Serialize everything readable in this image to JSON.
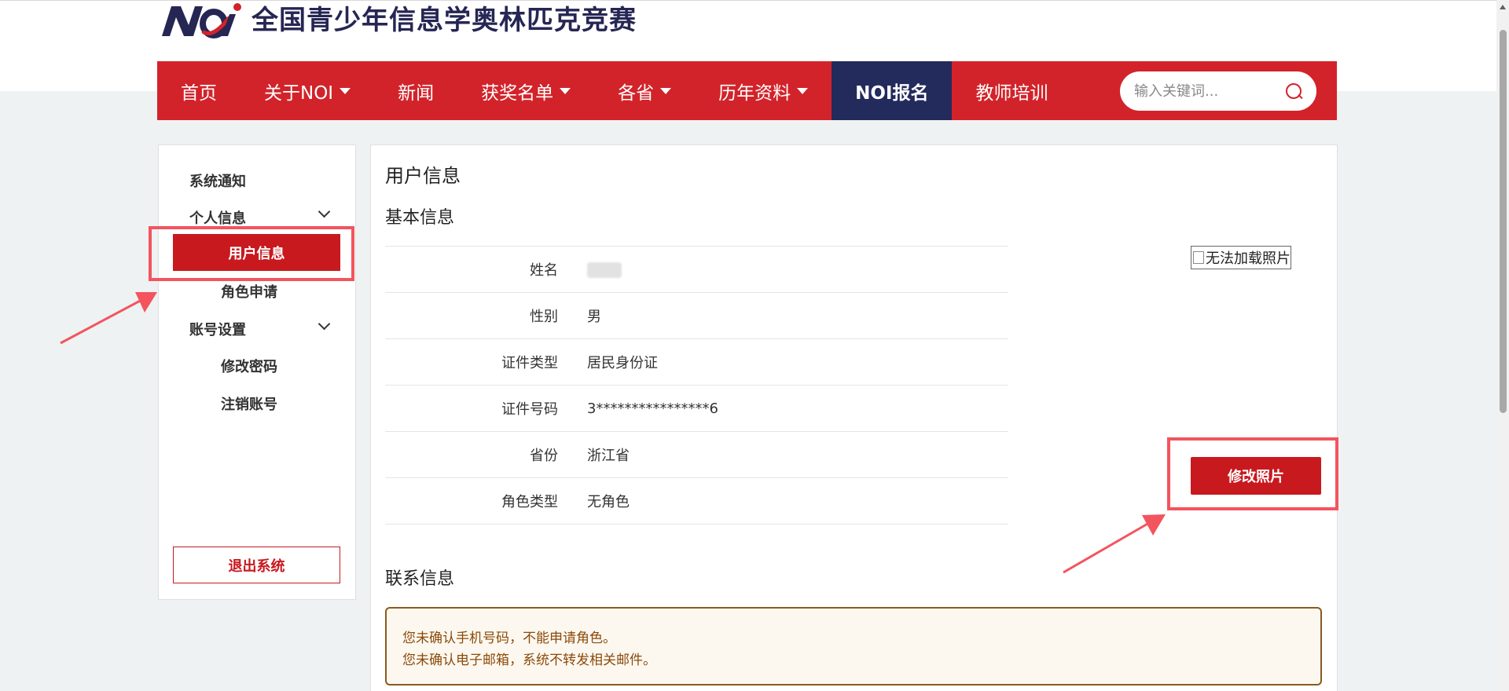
{
  "header": {
    "site_title": "全国青少年信息学奥林匹克竞赛",
    "logo_text": "NOI"
  },
  "nav": {
    "items": [
      {
        "label": "首页",
        "dropdown": false
      },
      {
        "label": "关于NOI",
        "dropdown": true
      },
      {
        "label": "新闻",
        "dropdown": false
      },
      {
        "label": "获奖名单",
        "dropdown": true
      },
      {
        "label": "各省",
        "dropdown": true
      },
      {
        "label": "历年资料",
        "dropdown": true
      },
      {
        "label": "NOI报名",
        "dropdown": false,
        "active": true
      },
      {
        "label": "教师培训",
        "dropdown": false
      }
    ],
    "search_placeholder": "输入关键词..."
  },
  "sidebar": {
    "system_notice": "系统通知",
    "personal_info": "个人信息",
    "user_info": "用户信息",
    "role_apply": "角色申请",
    "account_settings": "账号设置",
    "change_password": "修改密码",
    "cancel_account": "注销账号",
    "logout": "退出系统"
  },
  "main": {
    "title": "用户信息",
    "basic_section": "基本信息",
    "rows": [
      {
        "label": "姓名",
        "value": ""
      },
      {
        "label": "性别",
        "value": "男"
      },
      {
        "label": "证件类型",
        "value": "居民身份证"
      },
      {
        "label": "证件号码",
        "value": "3****************6"
      },
      {
        "label": "省份",
        "value": "浙江省"
      },
      {
        "label": "角色类型",
        "value": "无角色"
      }
    ],
    "photo_alt": "无法加载照片",
    "edit_photo": "修改照片",
    "contact_section": "联系信息",
    "alerts": [
      "您未确认手机号码，不能申请角色。",
      "您未确认电子邮箱，系统不转发相关邮件。"
    ]
  },
  "colors": {
    "brand_red": "#d2232a",
    "nav_active": "#232a5c",
    "highlight": "#f3545e"
  }
}
